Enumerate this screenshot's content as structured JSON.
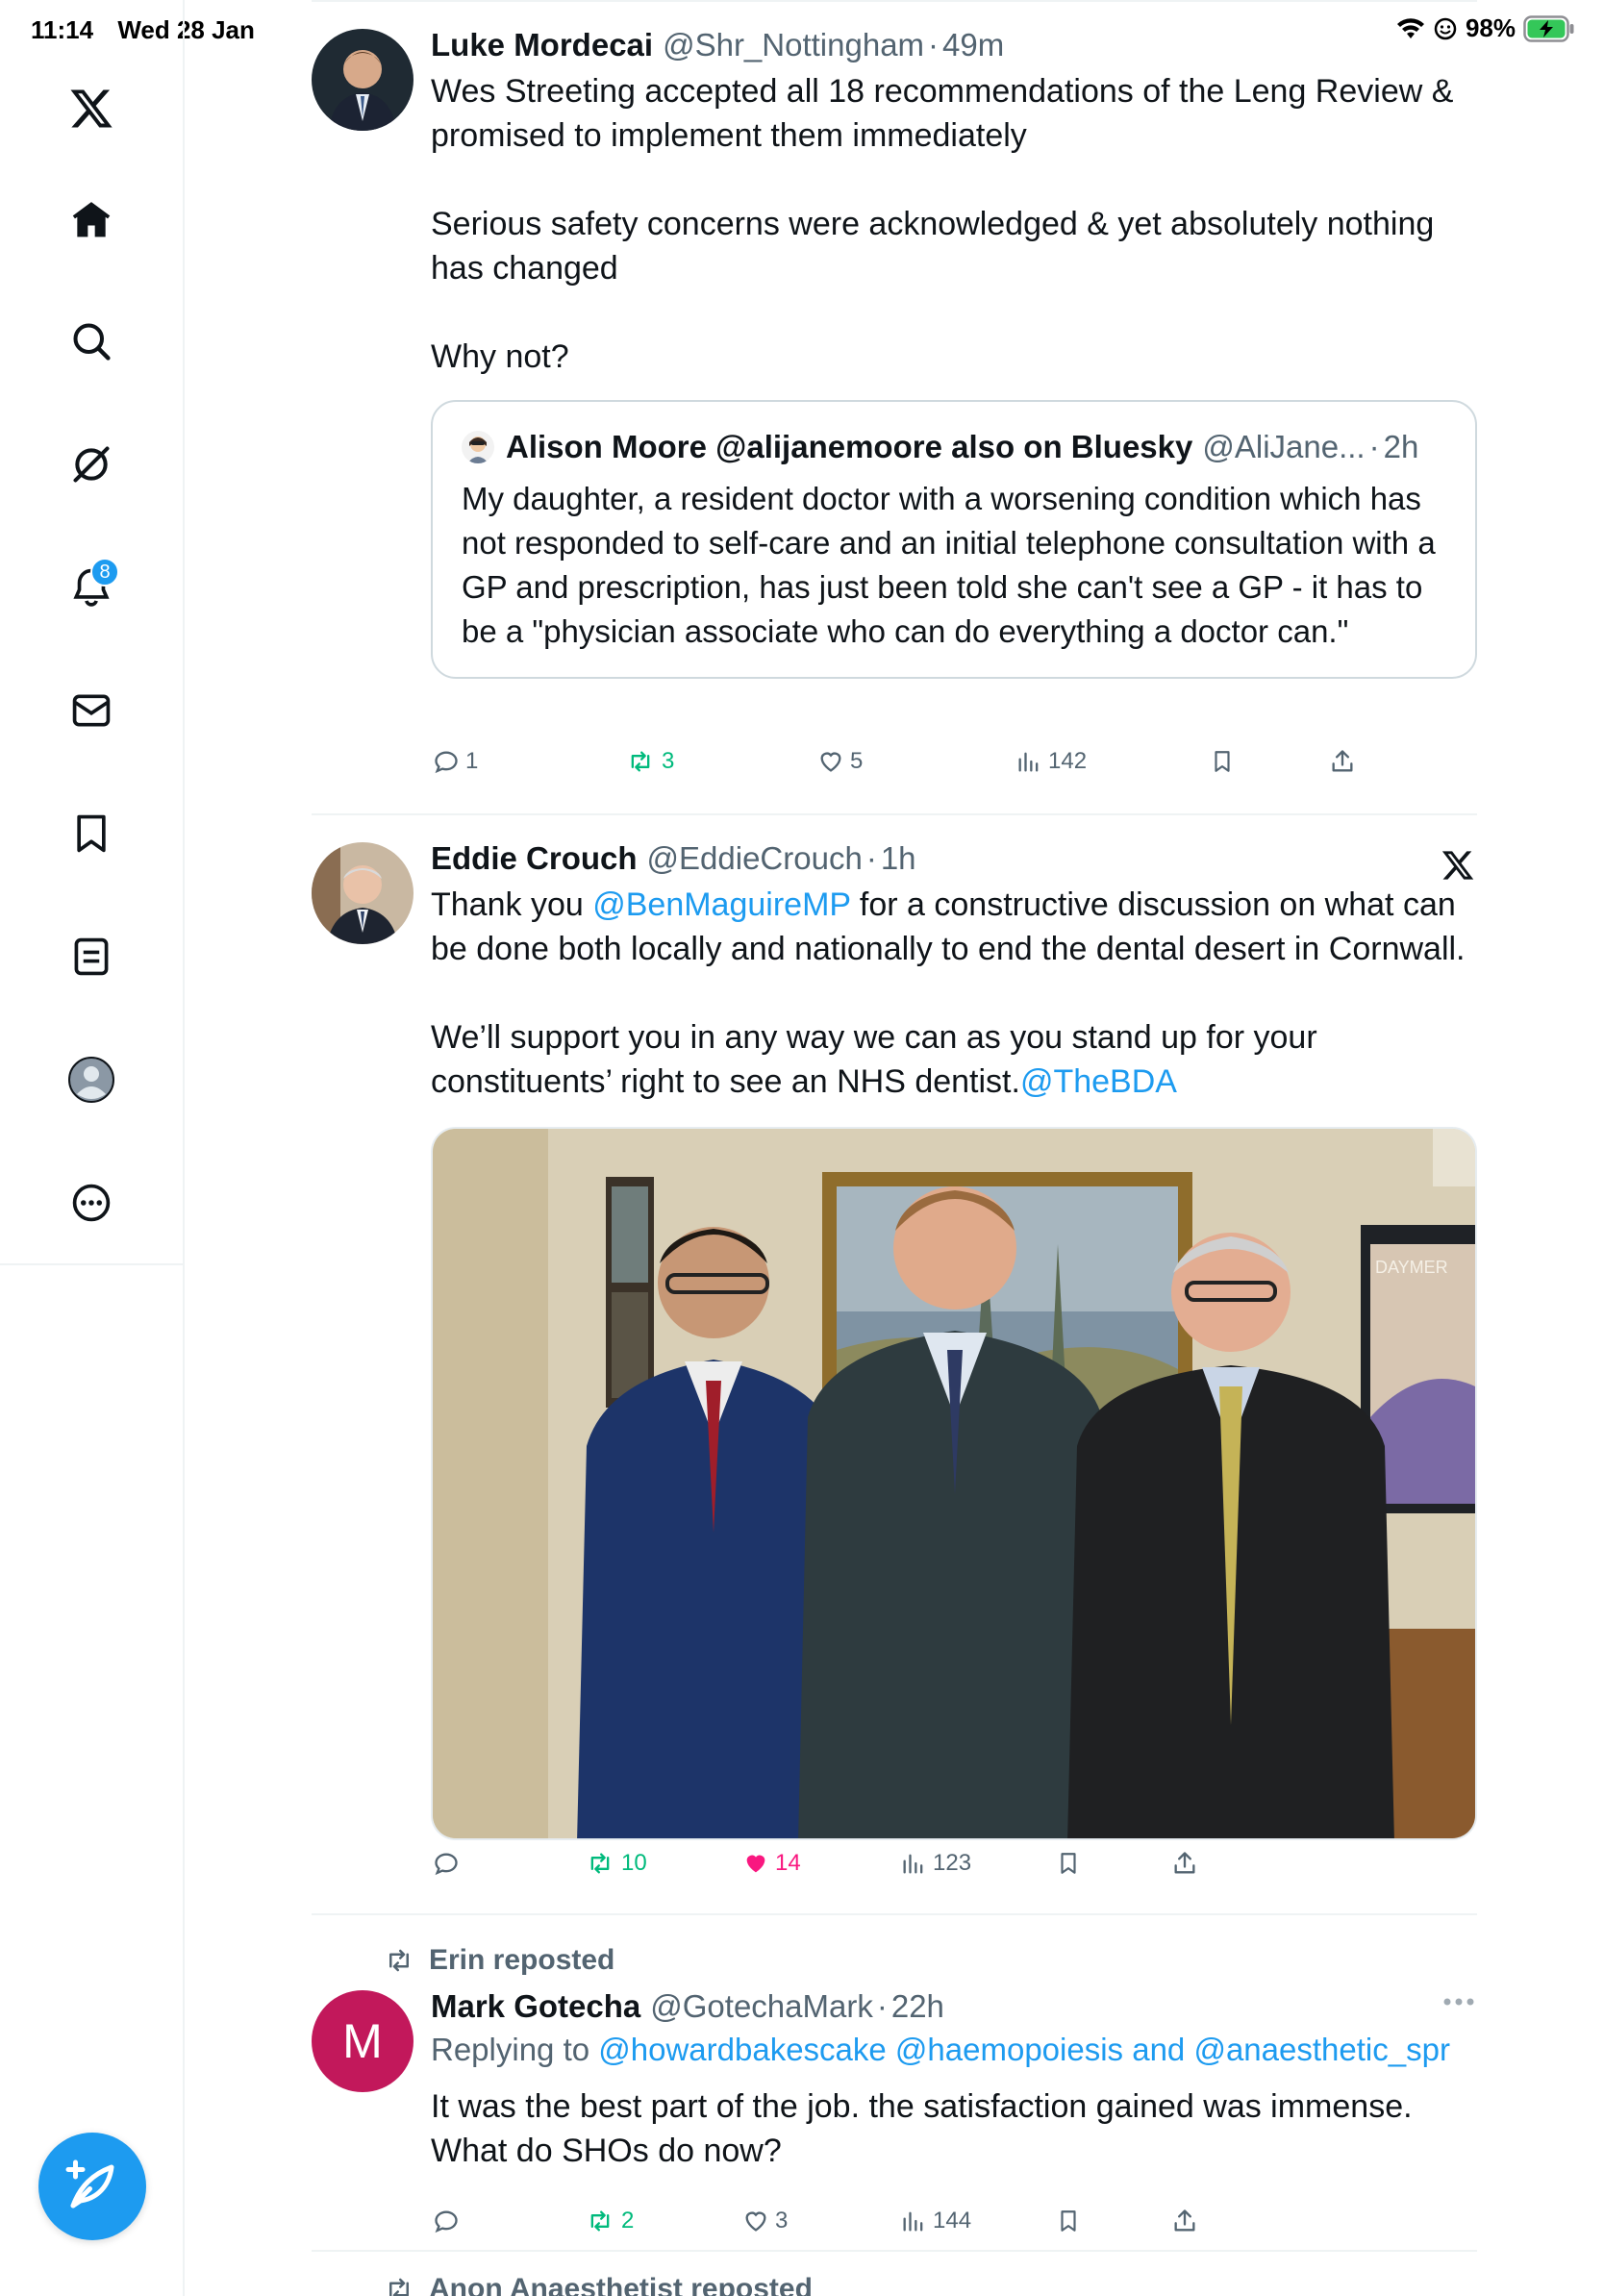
{
  "status_bar": {
    "time": "11:14",
    "date": "Wed 28 Jan",
    "battery": "98%"
  },
  "sidebar": {
    "badge_count": "8"
  },
  "tweets": [
    {
      "name": "Luke Mordecai",
      "handle": "@Shr_Nottingham",
      "time": "49m",
      "text_1": "Wes Streeting accepted all 18 recommendations of the Leng Review & promised to implement them immediately",
      "text_2": "Serious safety concerns were acknowledged & yet absolutely nothing has changed",
      "text_3": "Why not?",
      "quote": {
        "name": "Alison Moore @alijanemoore also on Bluesky",
        "handle": "@AliJane...",
        "time": "2h",
        "text": "My daughter, a resident doctor with a worsening condition which has not responded to self-care and an initial telephone consultation with a GP and prescription, has just been told she can't see a GP - it has to be a \"physician associate who can do everything a doctor can.\""
      },
      "replies": "1",
      "reposts": "3",
      "likes": "5",
      "views": "142"
    },
    {
      "name": "Eddie Crouch",
      "handle": "@EddieCrouch",
      "time": "1h",
      "text_1a": "Thank you ",
      "mention_1": "@BenMaguireMP",
      "text_1b": " for a constructive discussion on what can be done both locally and nationally to end the dental desert in Cornwall.",
      "text_2a": "We’ll support you in any way we can as you stand up for your constituents’ right to see an NHS dentist.",
      "mention_2": "@TheBDA",
      "poster_text": "DAYMER",
      "replies": "",
      "reposts": "10",
      "likes": "14",
      "views": "123"
    },
    {
      "repost_label": "Erin reposted",
      "avatar_letter": "M",
      "name": "Mark Gotecha",
      "handle": "@GotechaMark",
      "time": "22h",
      "replying_prefix": "Replying to ",
      "replying_to": "@howardbakescake @haemopoiesis and @anaesthetic_spr",
      "text": "It was the best part of the job. the satisfaction gained was immense. What do SHOs do now?",
      "replies": "",
      "reposts": "2",
      "likes": "3",
      "views": "144"
    }
  ],
  "next_item": {
    "repost_label": "Anon Anaesthetist reposted"
  },
  "colors": {
    "accent": "#1d9bf0",
    "repost_green": "#00ba7c",
    "like_pink": "#f91880",
    "secondary_text": "#536471",
    "avatar_magenta": "#c2185b"
  }
}
